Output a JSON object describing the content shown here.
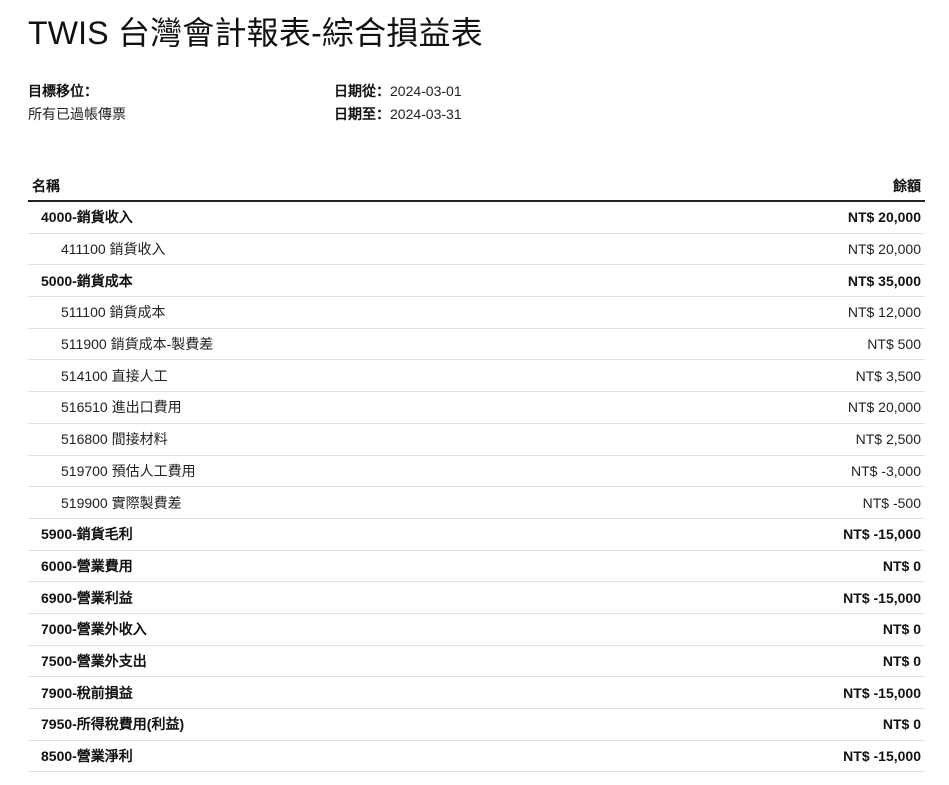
{
  "report": {
    "title": "TWIS 台灣會計報表-綜合損益表"
  },
  "filters": {
    "target_moves_label": "目標移位：",
    "target_moves_value": "所有已過帳傳票",
    "date_from_label": "日期從：",
    "date_from_value": "2024-03-01",
    "date_to_label": "日期至：",
    "date_to_value": "2024-03-31"
  },
  "table": {
    "headers": {
      "name": "名稱",
      "balance": "餘額"
    },
    "rows": [
      {
        "level": 0,
        "name": "4000-銷貨收入",
        "amount": "NT$ 20,000"
      },
      {
        "level": 1,
        "name": "411100 銷貨收入",
        "amount": "NT$ 20,000"
      },
      {
        "level": 0,
        "name": "5000-銷貨成本",
        "amount": "NT$ 35,000"
      },
      {
        "level": 1,
        "name": "511100 銷貨成本",
        "amount": "NT$ 12,000"
      },
      {
        "level": 1,
        "name": "511900 銷貨成本-製費差",
        "amount": "NT$ 500"
      },
      {
        "level": 1,
        "name": "514100 直接人工",
        "amount": "NT$ 3,500"
      },
      {
        "level": 1,
        "name": "516510 進出口費用",
        "amount": "NT$ 20,000"
      },
      {
        "level": 1,
        "name": "516800 間接材料",
        "amount": "NT$ 2,500"
      },
      {
        "level": 1,
        "name": "519700 預估人工費用",
        "amount": "NT$ -3,000"
      },
      {
        "level": 1,
        "name": "519900 實際製費差",
        "amount": "NT$ -500"
      },
      {
        "level": 0,
        "name": "5900-銷貨毛利",
        "amount": "NT$ -15,000"
      },
      {
        "level": 0,
        "name": "6000-營業費用",
        "amount": "NT$ 0"
      },
      {
        "level": 0,
        "name": "6900-營業利益",
        "amount": "NT$ -15,000"
      },
      {
        "level": 0,
        "name": "7000-營業外收入",
        "amount": "NT$ 0"
      },
      {
        "level": 0,
        "name": "7500-營業外支出",
        "amount": "NT$ 0"
      },
      {
        "level": 0,
        "name": "7900-稅前損益",
        "amount": "NT$ -15,000"
      },
      {
        "level": 0,
        "name": "7950-所得稅費用(利益)",
        "amount": "NT$ 0"
      },
      {
        "level": 0,
        "name": "8500-營業淨利",
        "amount": "NT$ -15,000"
      }
    ]
  }
}
